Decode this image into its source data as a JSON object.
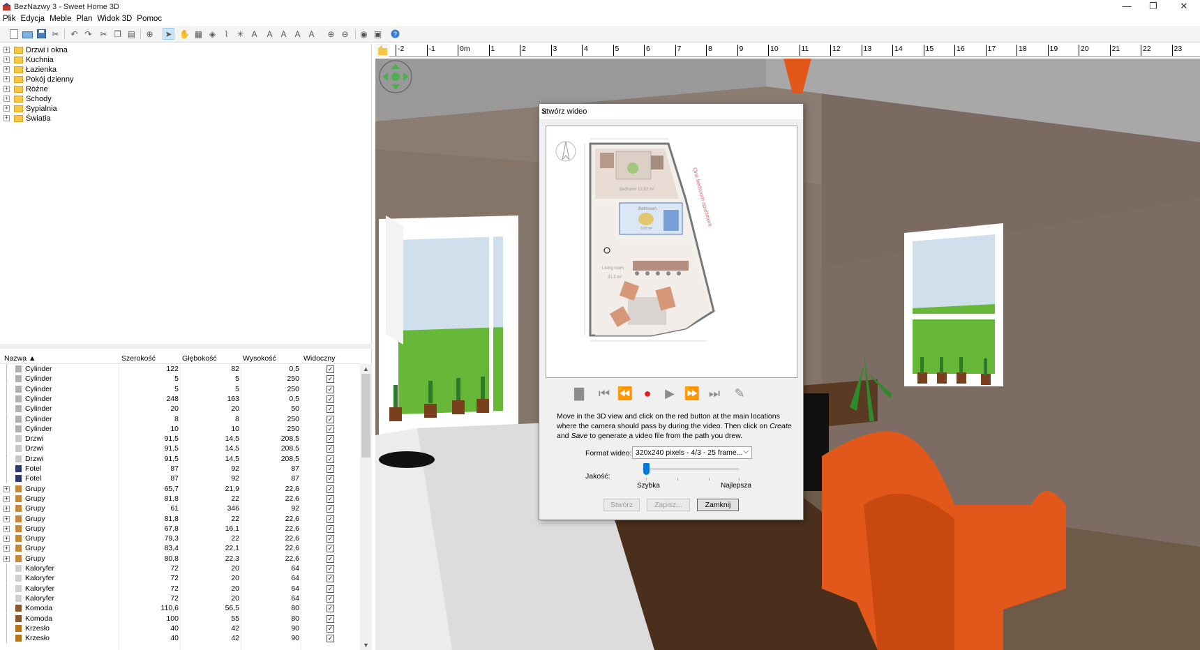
{
  "window": {
    "title": "BezNazwy 3 - Sweet Home 3D",
    "minimize": "—",
    "maximize": "❐",
    "close": "✕"
  },
  "menu": [
    "Plik",
    "Edycja",
    "Meble",
    "Plan",
    "Widok 3D",
    "Pomoc"
  ],
  "catalog": {
    "categories": [
      "Drzwi i okna",
      "Kuchnia",
      "Łazienka",
      "Pokój dzienny",
      "Różne",
      "Schody",
      "Sypialnia",
      "Światła"
    ]
  },
  "furniture_table": {
    "columns": [
      "Nazwa ▲",
      "Szerokość",
      "Głębokość",
      "Wysokość",
      "Widoczny"
    ],
    "rows": [
      {
        "name": "Cylinder",
        "w": "122",
        "d": "82",
        "h": "0,5",
        "icon": "cylinder",
        "group": false
      },
      {
        "name": "Cylinder",
        "w": "5",
        "d": "5",
        "h": "250",
        "icon": "cylinder",
        "group": false
      },
      {
        "name": "Cylinder",
        "w": "5",
        "d": "5",
        "h": "250",
        "icon": "cylinder",
        "group": false
      },
      {
        "name": "Cylinder",
        "w": "248",
        "d": "163",
        "h": "0,5",
        "icon": "cylinder",
        "group": false
      },
      {
        "name": "Cylinder",
        "w": "20",
        "d": "20",
        "h": "50",
        "icon": "cylinder",
        "group": false
      },
      {
        "name": "Cylinder",
        "w": "8",
        "d": "8",
        "h": "250",
        "icon": "cylinder",
        "group": false
      },
      {
        "name": "Cylinder",
        "w": "10",
        "d": "10",
        "h": "250",
        "icon": "cylinder",
        "group": false
      },
      {
        "name": "Drzwi",
        "w": "91,5",
        "d": "14,5",
        "h": "208,5",
        "icon": "door",
        "group": false
      },
      {
        "name": "Drzwi",
        "w": "91,5",
        "d": "14,5",
        "h": "208,5",
        "icon": "door",
        "group": false
      },
      {
        "name": "Drzwi",
        "w": "91,5",
        "d": "14,5",
        "h": "208,5",
        "icon": "door",
        "group": false
      },
      {
        "name": "Fotel",
        "w": "87",
        "d": "92",
        "h": "87",
        "icon": "armchair",
        "group": false
      },
      {
        "name": "Fotel",
        "w": "87",
        "d": "92",
        "h": "87",
        "icon": "armchair",
        "group": false
      },
      {
        "name": "Grupy",
        "w": "65,7",
        "d": "21,9",
        "h": "22,6",
        "icon": "group",
        "group": true
      },
      {
        "name": "Grupy",
        "w": "81,8",
        "d": "22",
        "h": "22,6",
        "icon": "group",
        "group": true
      },
      {
        "name": "Grupy",
        "w": "61",
        "d": "346",
        "h": "92",
        "icon": "group",
        "group": true
      },
      {
        "name": "Grupy",
        "w": "81,8",
        "d": "22",
        "h": "22,6",
        "icon": "group",
        "group": true
      },
      {
        "name": "Grupy",
        "w": "67,8",
        "d": "16,1",
        "h": "22,6",
        "icon": "group",
        "group": true
      },
      {
        "name": "Grupy",
        "w": "79,3",
        "d": "22",
        "h": "22,6",
        "icon": "group",
        "group": true
      },
      {
        "name": "Grupy",
        "w": "83,4",
        "d": "22,1",
        "h": "22,6",
        "icon": "group",
        "group": true
      },
      {
        "name": "Grupy",
        "w": "80,8",
        "d": "22,3",
        "h": "22,6",
        "icon": "group",
        "group": true
      },
      {
        "name": "Kaloryfer",
        "w": "72",
        "d": "20",
        "h": "64",
        "icon": "radiator",
        "group": false
      },
      {
        "name": "Kaloryfer",
        "w": "72",
        "d": "20",
        "h": "64",
        "icon": "radiator",
        "group": false
      },
      {
        "name": "Kaloryfer",
        "w": "72",
        "d": "20",
        "h": "64",
        "icon": "radiator",
        "group": false
      },
      {
        "name": "Kaloryfer",
        "w": "72",
        "d": "20",
        "h": "64",
        "icon": "radiator",
        "group": false
      },
      {
        "name": "Komoda",
        "w": "110,6",
        "d": "56,5",
        "h": "80",
        "icon": "dresser",
        "group": false
      },
      {
        "name": "Komoda",
        "w": "100",
        "d": "55",
        "h": "80",
        "icon": "dresser",
        "group": false
      },
      {
        "name": "Krzesło",
        "w": "40",
        "d": "42",
        "h": "90",
        "icon": "chair",
        "group": false
      },
      {
        "name": "Krzesło",
        "w": "40",
        "d": "42",
        "h": "90",
        "icon": "chair",
        "group": false
      }
    ],
    "visible_mark": "✓"
  },
  "ruler": {
    "labels": [
      "-2",
      "-1",
      "0m",
      "1",
      "2",
      "3",
      "4",
      "5",
      "6",
      "7",
      "8",
      "9",
      "10",
      "11",
      "12",
      "13",
      "14",
      "15",
      "16",
      "17",
      "18",
      "19",
      "20",
      "21",
      "22",
      "23"
    ]
  },
  "dialog": {
    "title": "Stwórz wideo",
    "close": "✕",
    "plan_labels": {
      "bedroom": "Bedroom  12,82 m²",
      "bathroom": "Bathroom",
      "bath_area": "3,60 m²",
      "living": "Living room",
      "living_area": "31,5 m²",
      "side_note": "One bedroom apartment"
    },
    "instructions_1": "Move in the 3D view and click on the red button at the main locations where the camera should pass by during the video. Then click on ",
    "instructions_create": "Create",
    "instructions_and": " and ",
    "instructions_save": "Save",
    "instructions_2": " to generate a video file from the path you drew.",
    "format_label": "Format wideo:",
    "format_value": "320x240 pixels - 4/3 - 25 frame...",
    "quality_label": "Jakość:",
    "quality_level": 0,
    "quality_min": "Szybka",
    "quality_max": "Najlepsza",
    "buttons": {
      "create": "Stwórz",
      "save": "Zapisz...",
      "close": "Zamknij"
    }
  }
}
